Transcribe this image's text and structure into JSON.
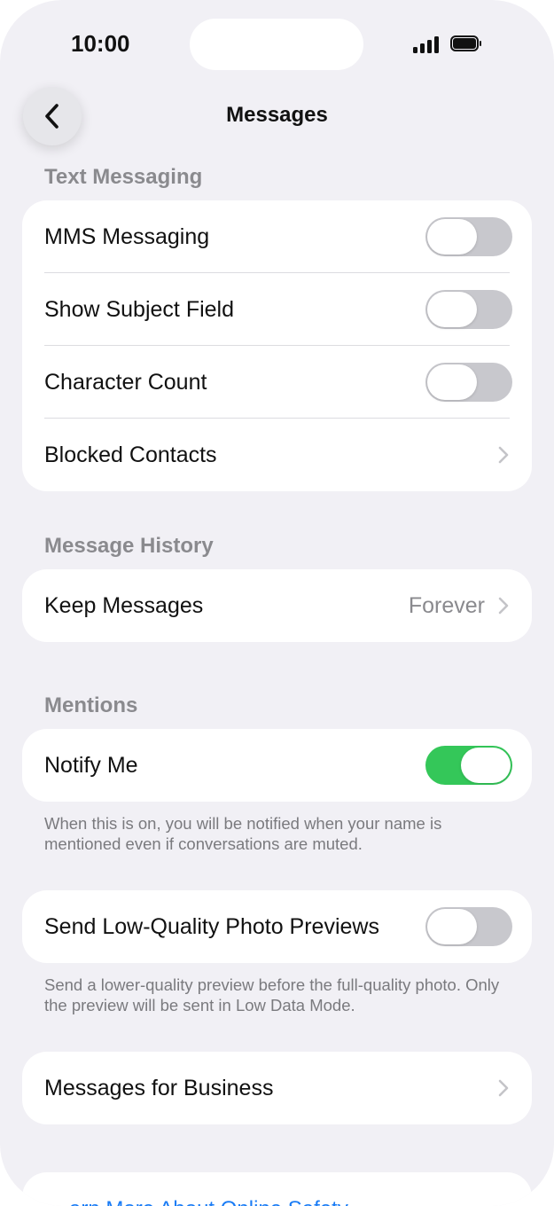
{
  "status_bar": {
    "time": "10:00"
  },
  "nav": {
    "title": "Messages"
  },
  "sections": {
    "text_messaging": {
      "header": "Text Messaging",
      "mms_label": "MMS Messaging",
      "subject_label": "Show Subject Field",
      "charcount_label": "Character Count",
      "blocked_label": "Blocked Contacts",
      "toggles": {
        "mms": false,
        "subject": false,
        "charcount": false
      }
    },
    "message_history": {
      "header": "Message History",
      "keep_label": "Keep Messages",
      "keep_value": "Forever"
    },
    "mentions": {
      "header": "Mentions",
      "notify_label": "Notify Me",
      "notify_on": true,
      "footnote": "When this is on, you will be notified when your name is mentioned even if conversations are muted."
    },
    "low_quality": {
      "label": "Send Low-Quality Photo Previews",
      "on": false,
      "footnote": "Send a lower-quality preview before the full-quality photo. Only the preview will be sent in Low Data Mode."
    },
    "business": {
      "label": "Messages for Business"
    },
    "learn_more": {
      "label": "arn More About Online Safety"
    }
  },
  "colors": {
    "toggle_on": "#34c759",
    "toggle_off": "#c8c8cd",
    "link": "#1a7cf5",
    "background": "#f1f0f5"
  },
  "icons": {
    "back": "chevron-left-icon",
    "disclosure": "chevron-right-icon"
  }
}
